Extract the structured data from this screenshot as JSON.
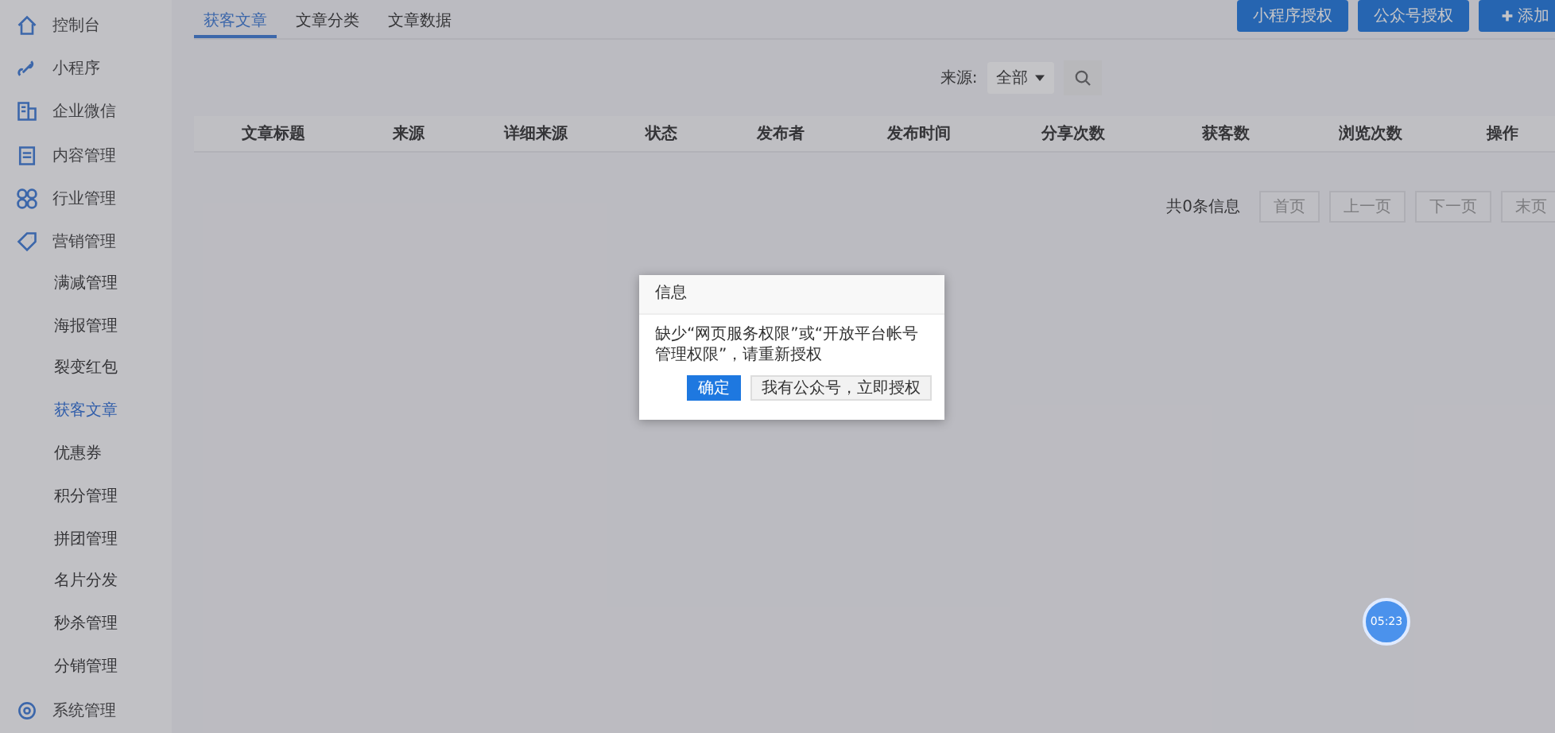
{
  "sidebar": {
    "items": [
      {
        "label": "控制台",
        "kind": "home",
        "selected": false
      },
      {
        "label": "小程序",
        "kind": "link",
        "selected": false
      },
      {
        "label": "企业微信",
        "kind": "building",
        "selected": false
      },
      {
        "label": "内容管理",
        "kind": "doc",
        "selected": false
      },
      {
        "label": "行业管理",
        "kind": "grid",
        "selected": false
      },
      {
        "label": "营销管理",
        "kind": "tag",
        "selected": false,
        "children": [
          {
            "label": "满减管理",
            "selected": false
          },
          {
            "label": "海报管理",
            "selected": false
          },
          {
            "label": "裂变红包",
            "selected": false
          },
          {
            "label": "获客文章",
            "selected": true
          },
          {
            "label": "优惠券",
            "selected": false
          },
          {
            "label": "积分管理",
            "selected": false
          },
          {
            "label": "拼团管理",
            "selected": false
          },
          {
            "label": "名片分发",
            "selected": false
          },
          {
            "label": "秒杀管理",
            "selected": false
          },
          {
            "label": "分销管理",
            "selected": false
          }
        ]
      },
      {
        "label": "系统管理",
        "kind": "gear",
        "selected": false
      }
    ]
  },
  "tabs": [
    {
      "label": "获客文章",
      "selected": true
    },
    {
      "label": "文章分类",
      "selected": false
    },
    {
      "label": "文章数据",
      "selected": false
    }
  ],
  "actions": [
    {
      "label": "小程序授权",
      "plus": false
    },
    {
      "label": "公众号授权",
      "plus": false
    },
    {
      "label": "添加",
      "plus": true
    }
  ],
  "filter": {
    "label": "来源:",
    "value": "全部"
  },
  "table": {
    "columns": [
      "文章标题",
      "来源",
      "详细来源",
      "状态",
      "发布者",
      "发布时间",
      "分享次数",
      "获客数",
      "浏览次数",
      "操作"
    ]
  },
  "pagination": {
    "summary": "共0条信息",
    "buttons": [
      "首页",
      "上一页",
      "下一页",
      "末页"
    ]
  },
  "dialog": {
    "title": "信息",
    "message": "缺少“网页服务权限”或“开放平台帐号管理权限”，请重新授权",
    "buttons": [
      {
        "label": "确定",
        "primary": true
      },
      {
        "label": "我有公众号，立即授权",
        "primary": false
      }
    ]
  },
  "timer": "05:23"
}
